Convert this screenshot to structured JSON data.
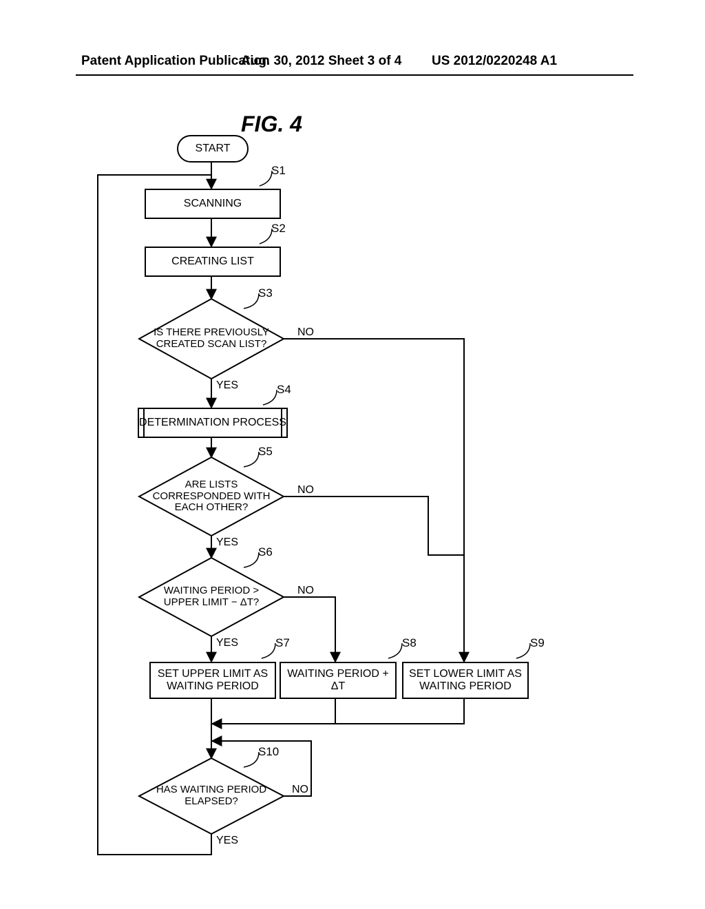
{
  "header": {
    "left": "Patent Application Publication",
    "middle": "Aug. 30, 2012  Sheet 3 of 4",
    "right": "US 2012/0220248 A1"
  },
  "figure_title": "FIG. 4",
  "nodes": {
    "start": "START",
    "s1": "SCANNING",
    "s2": "CREATING LIST",
    "s3": "IS THERE PREVIOUSLY CREATED SCAN LIST?",
    "s4": "DETERMINATION PROCESS",
    "s5": "ARE LISTS CORRESPONDED WITH EACH OTHER?",
    "s6": "WAITING PERIOD > UPPER LIMIT − ΔT?",
    "s7": "SET UPPER LIMIT AS WAITING PERIOD",
    "s8": "WAITING PERIOD + ΔT",
    "s9": "SET LOWER LIMIT AS WAITING PERIOD",
    "s10": "HAS WAITING PERIOD ELAPSED?"
  },
  "step_labels": {
    "s1": "S1",
    "s2": "S2",
    "s3": "S3",
    "s4": "S4",
    "s5": "S5",
    "s6": "S6",
    "s7": "S7",
    "s8": "S8",
    "s9": "S9",
    "s10": "S10"
  },
  "edge_labels": {
    "yes": "YES",
    "no": "NO"
  },
  "chart_data": {
    "type": "flowchart",
    "nodes": [
      {
        "id": "start",
        "type": "terminator",
        "label": "START"
      },
      {
        "id": "S1",
        "type": "process",
        "label": "SCANNING"
      },
      {
        "id": "S2",
        "type": "process",
        "label": "CREATING LIST"
      },
      {
        "id": "S3",
        "type": "decision",
        "label": "IS THERE PREVIOUSLY CREATED SCAN LIST?"
      },
      {
        "id": "S4",
        "type": "subprocess",
        "label": "DETERMINATION PROCESS"
      },
      {
        "id": "S5",
        "type": "decision",
        "label": "ARE LISTS CORRESPONDED WITH EACH OTHER?"
      },
      {
        "id": "S6",
        "type": "decision",
        "label": "WAITING PERIOD > UPPER LIMIT − ΔT?"
      },
      {
        "id": "S7",
        "type": "process",
        "label": "SET UPPER LIMIT AS WAITING PERIOD"
      },
      {
        "id": "S8",
        "type": "process",
        "label": "WAITING PERIOD + ΔT"
      },
      {
        "id": "S9",
        "type": "process",
        "label": "SET LOWER LIMIT AS WAITING PERIOD"
      },
      {
        "id": "S10",
        "type": "decision",
        "label": "HAS WAITING PERIOD ELAPSED?"
      }
    ],
    "edges": [
      {
        "from": "start",
        "to": "S1"
      },
      {
        "from": "S1",
        "to": "S2"
      },
      {
        "from": "S2",
        "to": "S3"
      },
      {
        "from": "S3",
        "to": "S4",
        "label": "YES"
      },
      {
        "from": "S3",
        "to": "S9",
        "label": "NO"
      },
      {
        "from": "S4",
        "to": "S5"
      },
      {
        "from": "S5",
        "to": "S6",
        "label": "YES"
      },
      {
        "from": "S5",
        "to": "S9",
        "label": "NO"
      },
      {
        "from": "S6",
        "to": "S7",
        "label": "YES"
      },
      {
        "from": "S6",
        "to": "S8",
        "label": "NO"
      },
      {
        "from": "S7",
        "to": "S10"
      },
      {
        "from": "S8",
        "to": "S10"
      },
      {
        "from": "S9",
        "to": "S10"
      },
      {
        "from": "S10",
        "to": "S10",
        "label": "NO"
      },
      {
        "from": "S10",
        "to": "S1",
        "label": "YES"
      }
    ]
  }
}
